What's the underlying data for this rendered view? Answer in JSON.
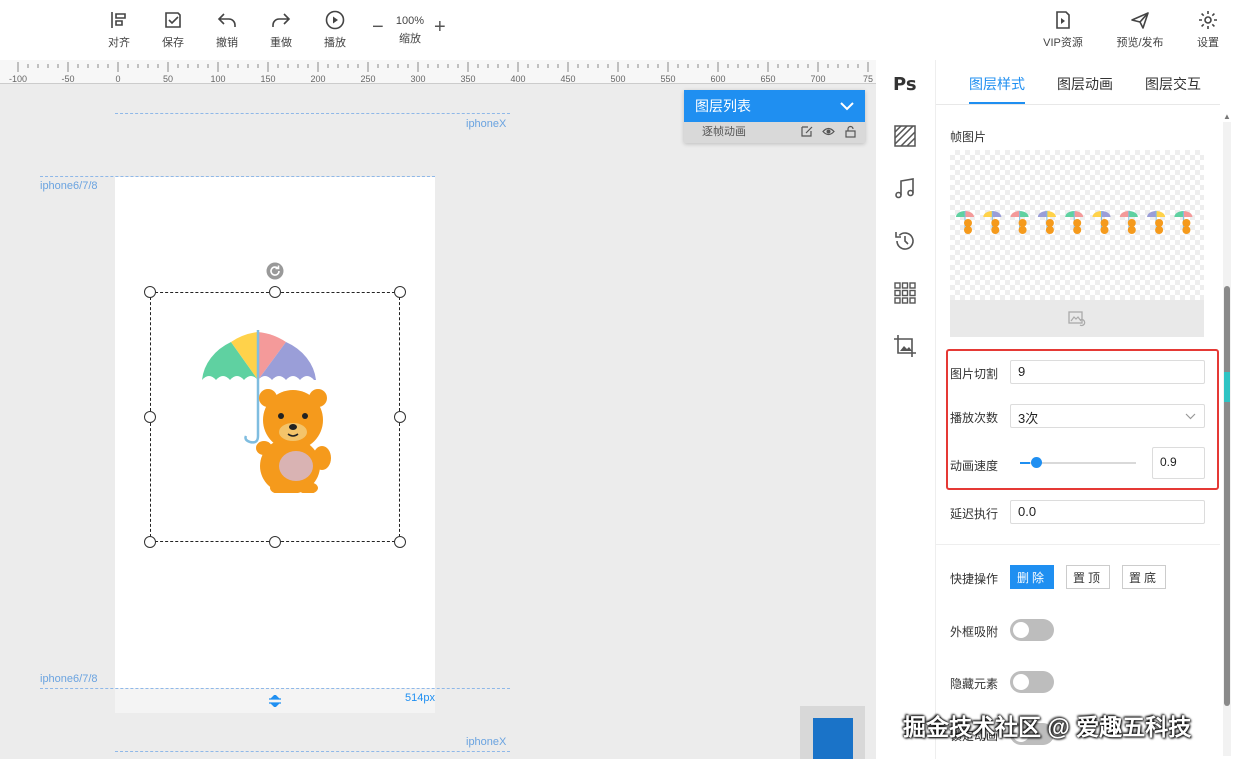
{
  "toolbar": {
    "align_label": "对齐",
    "save_label": "保存",
    "undo_label": "撤销",
    "redo_label": "重做",
    "play_label": "播放",
    "zoom_value": "100%",
    "zoom_label": "缩放",
    "zoom_minus": "−",
    "zoom_plus": "+",
    "vip_label": "VIP资源",
    "preview_label": "预览/发布",
    "settings_label": "设置"
  },
  "canvas": {
    "ruler_ticks": [
      "-100",
      "-50",
      "0",
      "50",
      "100",
      "150",
      "200",
      "250",
      "300",
      "350",
      "400",
      "450",
      "500",
      "550",
      "600",
      "650",
      "700",
      "75"
    ],
    "guides": {
      "iphonex_top": "iphoneX",
      "iphone678_top": "iphone6/7/8",
      "iphone678_bottom": "iphone6/7/8",
      "iphonex_bottom": "iphoneX"
    },
    "height_readout": "514px",
    "accent_color": "#1f8ff1"
  },
  "layer_panel": {
    "title": "图层列表",
    "items": [
      {
        "label": "逐帧动画"
      }
    ]
  },
  "side_strip": {
    "icons": [
      "ps-icon",
      "texture-icon",
      "music-icon",
      "history-icon",
      "grid-icon",
      "image-crop-icon"
    ],
    "ps_text": "Ps"
  },
  "panel": {
    "tabs": [
      "图层样式",
      "图层动画",
      "图层交互"
    ],
    "active_tab": "图层样式",
    "frame_image_label": "帧图片",
    "frame_count_visible": 9,
    "slice": {
      "label": "图片切割",
      "value": "9"
    },
    "play_count": {
      "label": "播放次数",
      "value": "3次",
      "options_visible": [
        "3次"
      ]
    },
    "speed": {
      "label": "动画速度",
      "value": "0.9",
      "slider_fraction": 0.09
    },
    "delay": {
      "label": "延迟执行",
      "value": "0.0"
    },
    "quick_ops": {
      "label": "快捷操作",
      "delete": "删除",
      "top": "置顶",
      "bottom": "置底"
    },
    "snap": {
      "label": "外框吸附",
      "on": false
    },
    "hide": {
      "label": "隐藏元素",
      "on": false
    },
    "lock": {
      "label": "锁定动画",
      "on": false
    },
    "highlight_color": "#e53935"
  },
  "watermark": "掘金技术社区 @ 爱趣五科技"
}
